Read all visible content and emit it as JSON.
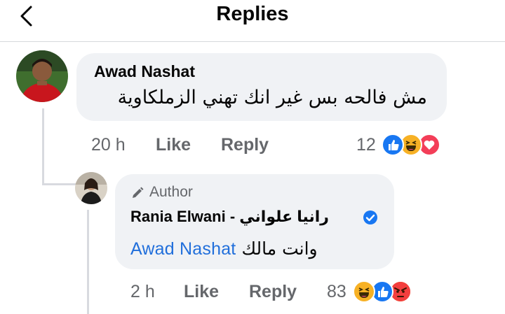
{
  "header": {
    "title": "Replies",
    "back_icon": "chevron-left-icon"
  },
  "comment": {
    "author": "Awad Nashat",
    "text": "مش فالحه بس غير انك تهني الزملكاوية",
    "time": "20 h",
    "like_label": "Like",
    "reply_label": "Reply",
    "reaction_count": "12",
    "reactions": [
      "like-reaction-icon",
      "haha-reaction-icon",
      "love-reaction-icon"
    ]
  },
  "reply": {
    "author_badge": "Author",
    "author_name": "Rania Elwani - رانيا علواني",
    "mention": "Awad Nashat",
    "text": "وانت مالك",
    "time": "2 h",
    "like_label": "Like",
    "reply_label": "Reply",
    "reaction_count": "83",
    "reactions": [
      "haha-reaction-icon",
      "like-reaction-icon",
      "angry-reaction-icon"
    ]
  },
  "colors": {
    "bubble": "#f0f2f5",
    "meta": "#65676b",
    "mention": "#216fdb",
    "like_blue": "#1877f2",
    "love_red": "#f33e58",
    "haha_yellow": "#f7b125",
    "angry_red": "#e9710f"
  }
}
